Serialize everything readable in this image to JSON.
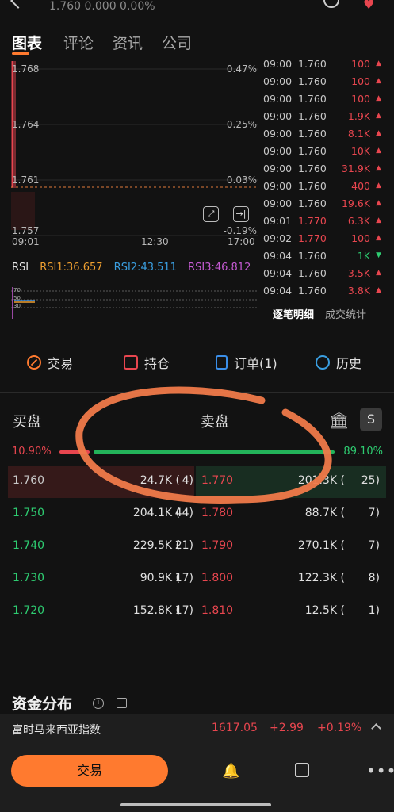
{
  "header": {
    "quote": "1.760 0.000 0.00%"
  },
  "tabs": [
    "图表",
    "评论",
    "资讯",
    "公司"
  ],
  "chart": {
    "price_labels": [
      "1.768",
      "1.764",
      "1.761",
      "1.757"
    ],
    "pct_labels": [
      "0.47%",
      "0.25%",
      "0.03%",
      "-0.19%"
    ],
    "time_labels": [
      "09:01",
      "12:30",
      "17:00"
    ]
  },
  "rsi": {
    "label": "RSI",
    "rsi1": "RSI1:36.657",
    "rsi2": "RSI2:43.511",
    "rsi3": "RSI3:46.812",
    "levels": [
      "70",
      "50",
      "30"
    ]
  },
  "ticker": {
    "rows": [
      {
        "time": "09:00",
        "price": "1.760",
        "vol": "100",
        "dir": "down"
      },
      {
        "time": "09:00",
        "price": "1.760",
        "vol": "100",
        "dir": "down"
      },
      {
        "time": "09:00",
        "price": "1.760",
        "vol": "100",
        "dir": "down"
      },
      {
        "time": "09:00",
        "price": "1.760",
        "vol": "1.9K",
        "dir": "down"
      },
      {
        "time": "09:00",
        "price": "1.760",
        "vol": "8.1K",
        "dir": "down"
      },
      {
        "time": "09:00",
        "price": "1.760",
        "vol": "10K",
        "dir": "down"
      },
      {
        "time": "09:00",
        "price": "1.760",
        "vol": "31.9K",
        "dir": "down"
      },
      {
        "time": "09:00",
        "price": "1.760",
        "vol": "400",
        "dir": "down"
      },
      {
        "time": "09:00",
        "price": "1.760",
        "vol": "19.6K",
        "dir": "down"
      },
      {
        "time": "09:01",
        "price": "1.770",
        "vol": "6.3K",
        "dir": "down"
      },
      {
        "time": "09:02",
        "price": "1.770",
        "vol": "100",
        "dir": "down"
      },
      {
        "time": "09:04",
        "price": "1.760",
        "vol": "1K",
        "dir": "up"
      },
      {
        "time": "09:04",
        "price": "1.760",
        "vol": "3.5K",
        "dir": "down"
      },
      {
        "time": "09:04",
        "price": "1.760",
        "vol": "3.8K",
        "dir": "down"
      }
    ],
    "tab_detail": "逐笔明细",
    "tab_stats": "成交统计"
  },
  "actions": {
    "trade": "交易",
    "positions": "持仓",
    "orders": "订单(1)",
    "history": "历史"
  },
  "orderbook": {
    "buy_title": "买盘",
    "sell_title": "卖盘",
    "s_button": "S",
    "buy_pct": "10.90%",
    "sell_pct": "89.10%",
    "buy_ratio": 0.109,
    "rows": [
      {
        "bp": "1.760",
        "bv": "24.7K (",
        "bc": "4)",
        "sp": "1.770",
        "sv": "201.3K (",
        "sc": "25)"
      },
      {
        "bp": "1.750",
        "bv": "204.1K (",
        "bc": "44)",
        "sp": "1.780",
        "sv": "88.7K (",
        "sc": "7)"
      },
      {
        "bp": "1.740",
        "bv": "229.5K (",
        "bc": "21)",
        "sp": "1.790",
        "sv": "270.1K (",
        "sc": "7)"
      },
      {
        "bp": "1.730",
        "bv": "90.9K (",
        "bc": "17)",
        "sp": "1.800",
        "sv": "122.3K (",
        "sc": "8)"
      },
      {
        "bp": "1.720",
        "bv": "152.8K (",
        "bc": "17)",
        "sp": "1.810",
        "sv": "12.5K (",
        "sc": "1)"
      }
    ]
  },
  "capital": {
    "title": "资金分布"
  },
  "index_bar": {
    "name": "富时马来西亚指数",
    "value": "1617.05",
    "change": "+2.99",
    "pct": "+0.19%"
  },
  "bottom": {
    "trade_button": "交易"
  },
  "colors": {
    "accent": "#ff7a2f",
    "up": "#e8464f",
    "down": "#2ecc71",
    "background": "#121212"
  }
}
